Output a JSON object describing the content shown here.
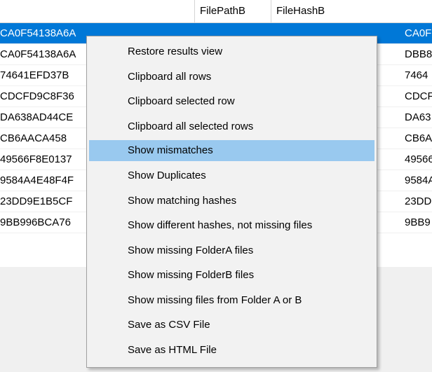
{
  "grid": {
    "columns": [
      {
        "label": ""
      },
      {
        "label": "FilePathB"
      },
      {
        "label": "FileHashB"
      }
    ],
    "rows": [
      {
        "hash_a": "CA0F54138A6A",
        "hash_b": "CA0F5",
        "selected": true
      },
      {
        "hash_a": "CA0F54138A6A",
        "hash_b": "DBB8"
      },
      {
        "hash_a": "74641EFD37B",
        "hash_b": "7464"
      },
      {
        "hash_a": "CDCFD9C8F36",
        "hash_b": "CDCF"
      },
      {
        "hash_a": "DA638AD44CE",
        "hash_b": "DA63"
      },
      {
        "hash_a": "CB6AACA458",
        "hash_b": "CB6A"
      },
      {
        "hash_a": "49566F8E0137",
        "hash_b": "49566"
      },
      {
        "hash_a": "9584A4E48F4F",
        "hash_b": "9584A"
      },
      {
        "hash_a": "23DD9E1B5CF",
        "hash_b": "23DD"
      },
      {
        "hash_a": "9BB996BCA76",
        "hash_b": "9BB9"
      }
    ]
  },
  "context_menu": {
    "items": [
      {
        "label": "Restore results view"
      },
      {
        "label": "Clipboard all rows"
      },
      {
        "label": "Clipboard selected row"
      },
      {
        "label": "Clipboard all selected rows"
      },
      {
        "label": "Show mismatches",
        "highlighted": true
      },
      {
        "label": "Show Duplicates"
      },
      {
        "label": "Show matching hashes"
      },
      {
        "label": "Show different hashes, not missing files"
      },
      {
        "label": "Show missing FolderA files"
      },
      {
        "label": "Show missing FolderB files"
      },
      {
        "label": "Show missing files from Folder A or B"
      },
      {
        "label": "Save as CSV File"
      },
      {
        "label": "Save as HTML File"
      }
    ]
  },
  "colors": {
    "selection": "#0078d7",
    "menu_highlight": "#99c9ef",
    "menu_background": "#f2f2f2"
  }
}
